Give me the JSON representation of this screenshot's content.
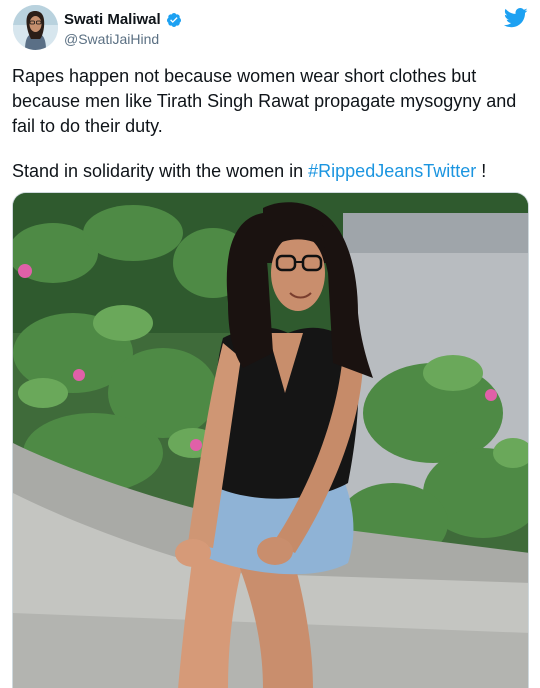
{
  "author": {
    "display_name": "Swati Maliwal",
    "handle": "@SwatiJaiHind",
    "verified": true,
    "avatar_icon": "profile-photo"
  },
  "brand": {
    "icon": "twitter-bird-icon",
    "color": "#1da1f2"
  },
  "tweet": {
    "text": "Rapes happen not because women wear short clothes but because men like Tirath Singh Rawat propagate mysogyny and fail to do their duty.",
    "line2_prefix": "Stand in solidarity with the women in ",
    "hashtag": "#RippedJeansTwitter",
    "line2_suffix": " !",
    "hashtag_color": "#1b95e0"
  },
  "media": {
    "type": "photo"
  }
}
